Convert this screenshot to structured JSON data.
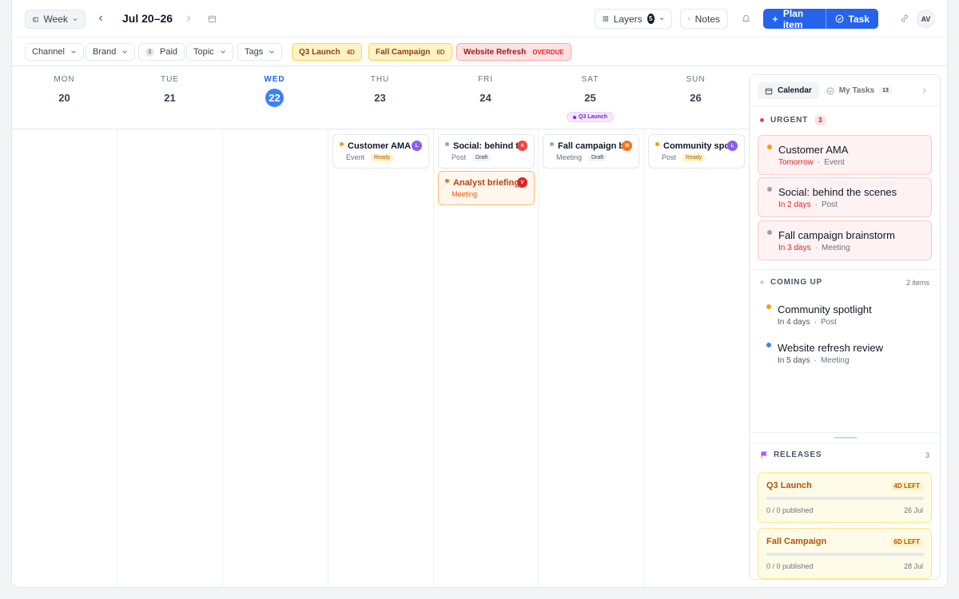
{
  "toolbar": {
    "view_label": "Week",
    "range_label": "Jul 20–26",
    "layers_label": "Layers",
    "layers_count": "5",
    "notes_label": "Notes",
    "plan_item_label": "Plan item",
    "task_label": "Task",
    "avatar_initials": "AV"
  },
  "filters": {
    "channel": "Channel",
    "brand": "Brand",
    "paid": "Paid",
    "paid_symbol": "$",
    "topic": "Topic",
    "tags": "Tags",
    "chips": [
      {
        "label": "Q3 Launch",
        "tag": "4D"
      },
      {
        "label": "Fall Campaign",
        "tag": "6D"
      },
      {
        "label": "Website Refresh",
        "tag": "OVERDUE"
      }
    ]
  },
  "calendar": {
    "days": [
      {
        "dow": "MON",
        "num": "20"
      },
      {
        "dow": "TUE",
        "num": "21"
      },
      {
        "dow": "WED",
        "num": "22"
      },
      {
        "dow": "THU",
        "num": "23"
      },
      {
        "dow": "FRI",
        "num": "24"
      },
      {
        "dow": "SAT",
        "num": "25"
      },
      {
        "dow": "SUN",
        "num": "26"
      }
    ],
    "sat_tag": "Q3 Launch",
    "events": [
      {
        "title": "Customer AMA",
        "type": "Event",
        "status": "Ready",
        "avatar": "L"
      },
      {
        "title": "Social: behind the scenes",
        "type": "Post",
        "status": "Draft",
        "avatar": "A"
      },
      {
        "title": "Analyst briefing",
        "type": "Meeting",
        "status": "",
        "avatar": "V"
      },
      {
        "title": "Fall campaign brainstorm",
        "type": "Meeting",
        "status": "Draft",
        "avatar": "M"
      },
      {
        "title": "Community spotlight",
        "type": "Post",
        "status": "Ready",
        "avatar": "L"
      }
    ]
  },
  "panel": {
    "tab_calendar": "Calendar",
    "tab_tasks": "My Tasks",
    "tasks_count": "13",
    "urgent_label": "URGENT",
    "urgent_count": "3",
    "urgent_items": [
      {
        "title": "Customer AMA",
        "when": "Tomorrow",
        "type": "Event"
      },
      {
        "title": "Social: behind the scenes",
        "when": "In 2 days",
        "type": "Post"
      },
      {
        "title": "Fall campaign brainstorm",
        "when": "In 3 days",
        "type": "Meeting"
      }
    ],
    "coming_label": "COMING UP",
    "coming_count": "2 items",
    "coming_items": [
      {
        "title": "Community spotlight",
        "when": "In 4 days",
        "type": "Post"
      },
      {
        "title": "Website refresh review",
        "when": "In 5 days",
        "type": "Meeting"
      }
    ],
    "releases_label": "RELEASES",
    "releases_count": "3",
    "releases": [
      {
        "name": "Q3 Launch",
        "left": "4D LEFT",
        "published": "0 / 0 published",
        "date": "26 Jul",
        "progress": 0
      },
      {
        "name": "Fall Campaign",
        "left": "6D LEFT",
        "published": "0 / 0 published",
        "date": "28 Jul",
        "progress": 0
      }
    ]
  },
  "separator": "·",
  "colors": {
    "primary": "#2563eb",
    "urgent": "#dc2626",
    "warning": "#f59e0b",
    "release_accent": "#b45309"
  }
}
